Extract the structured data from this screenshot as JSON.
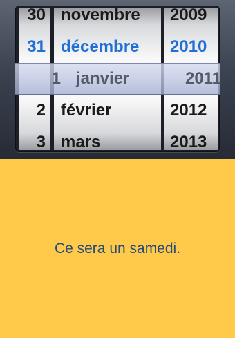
{
  "picker": {
    "days": [
      "30",
      "31",
      "1",
      "2",
      "3"
    ],
    "months": [
      "novembre",
      "décembre",
      "janvier",
      "février",
      "mars"
    ],
    "years": [
      "2009",
      "2010",
      "2011",
      "2012",
      "2013"
    ],
    "selected_day": "31",
    "selected_month": "décembre",
    "selected_year": "2010",
    "band_day": "1",
    "band_month": "janvier",
    "band_year": "2011"
  },
  "message": "Ce sera un samedi.",
  "colors": {
    "background": "#ffc94a",
    "selected_text": "#1f6fd6",
    "message_text": "#254a7c"
  }
}
